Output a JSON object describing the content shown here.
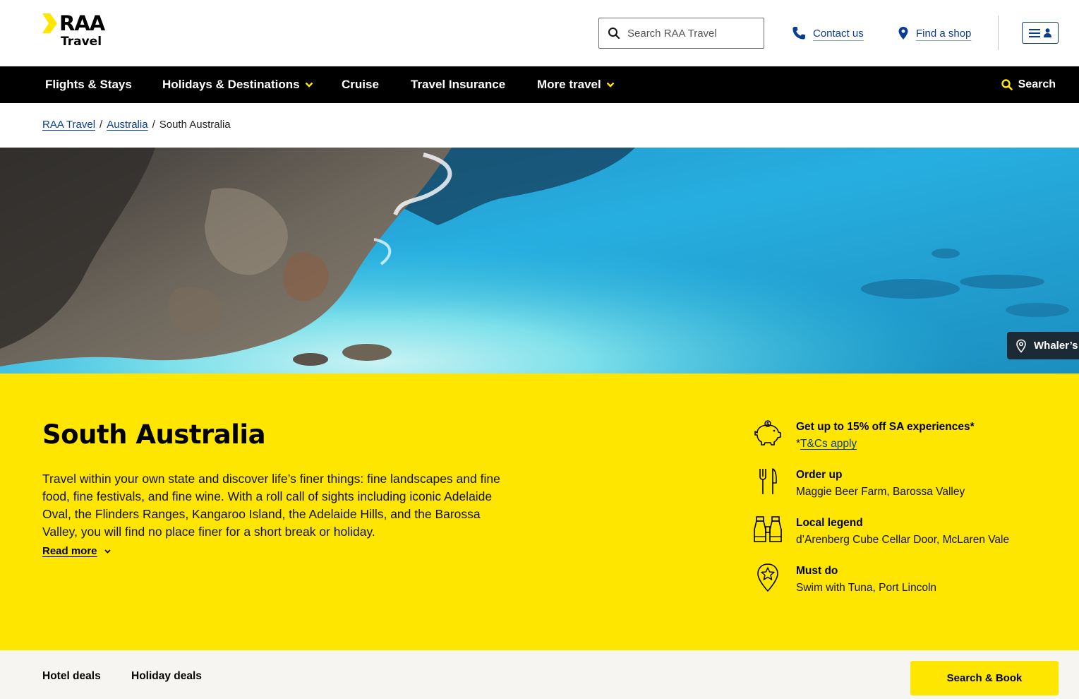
{
  "brand": {
    "name": "RAA",
    "sub": "Travel",
    "accent": "#ffe600"
  },
  "header": {
    "search_placeholder": "Search RAA Travel",
    "contact_label": "Contact us",
    "find_shop_label": "Find a shop",
    "icons": {
      "search": "search-icon",
      "contact": "phone-icon",
      "find_shop": "map-pin-icon",
      "menu": "hamburger-account-icon"
    }
  },
  "nav": {
    "items": [
      {
        "label": "Flights & Stays"
      },
      {
        "label": "Holidays & Destinations"
      },
      {
        "label": "Cruise"
      },
      {
        "label": "Travel Insurance"
      },
      {
        "label": "More travel"
      }
    ],
    "search_label": "Search"
  },
  "breadcrumb": {
    "items": [
      {
        "label": "RAA Travel"
      },
      {
        "label": "Australia"
      },
      {
        "label": "South Australia"
      }
    ],
    "separator": "/"
  },
  "hero": {
    "location_label": "Whaler’s"
  },
  "main": {
    "title": "South Australia",
    "intro": "Travel within your own state and discover life’s finer things: fine landscapes and fine food, fine festivals, and fine wine. With a roll call of sights including iconic Adelaide Oval, the Flinders Ranges, Kangaroo Island, the Adelaide Hills, and the Barossa Valley, you will find no place finer for a short break or holiday.",
    "read_more": "Read more"
  },
  "highlights": [
    {
      "icon": "piggy-bank-icon",
      "title": "Get up to 15% off SA experiences*",
      "sub_prefix": "*",
      "sub_link": "T&Cs apply"
    },
    {
      "icon": "fork-knife-icon",
      "title": "Order up",
      "sub": "Maggie Beer Farm, Barossa Valley"
    },
    {
      "icon": "binoculars-icon",
      "title": "Local legend",
      "sub": "d’Arenberg Cube Cellar Door, McLaren Vale"
    },
    {
      "icon": "star-pin-icon",
      "title": "Must do",
      "sub": "Swim with Tuna, Port Lincoln"
    }
  ],
  "bottom": {
    "tabs": [
      {
        "label": "Hotel deals"
      },
      {
        "label": "Holiday deals"
      }
    ],
    "cta": "Search & Book"
  }
}
